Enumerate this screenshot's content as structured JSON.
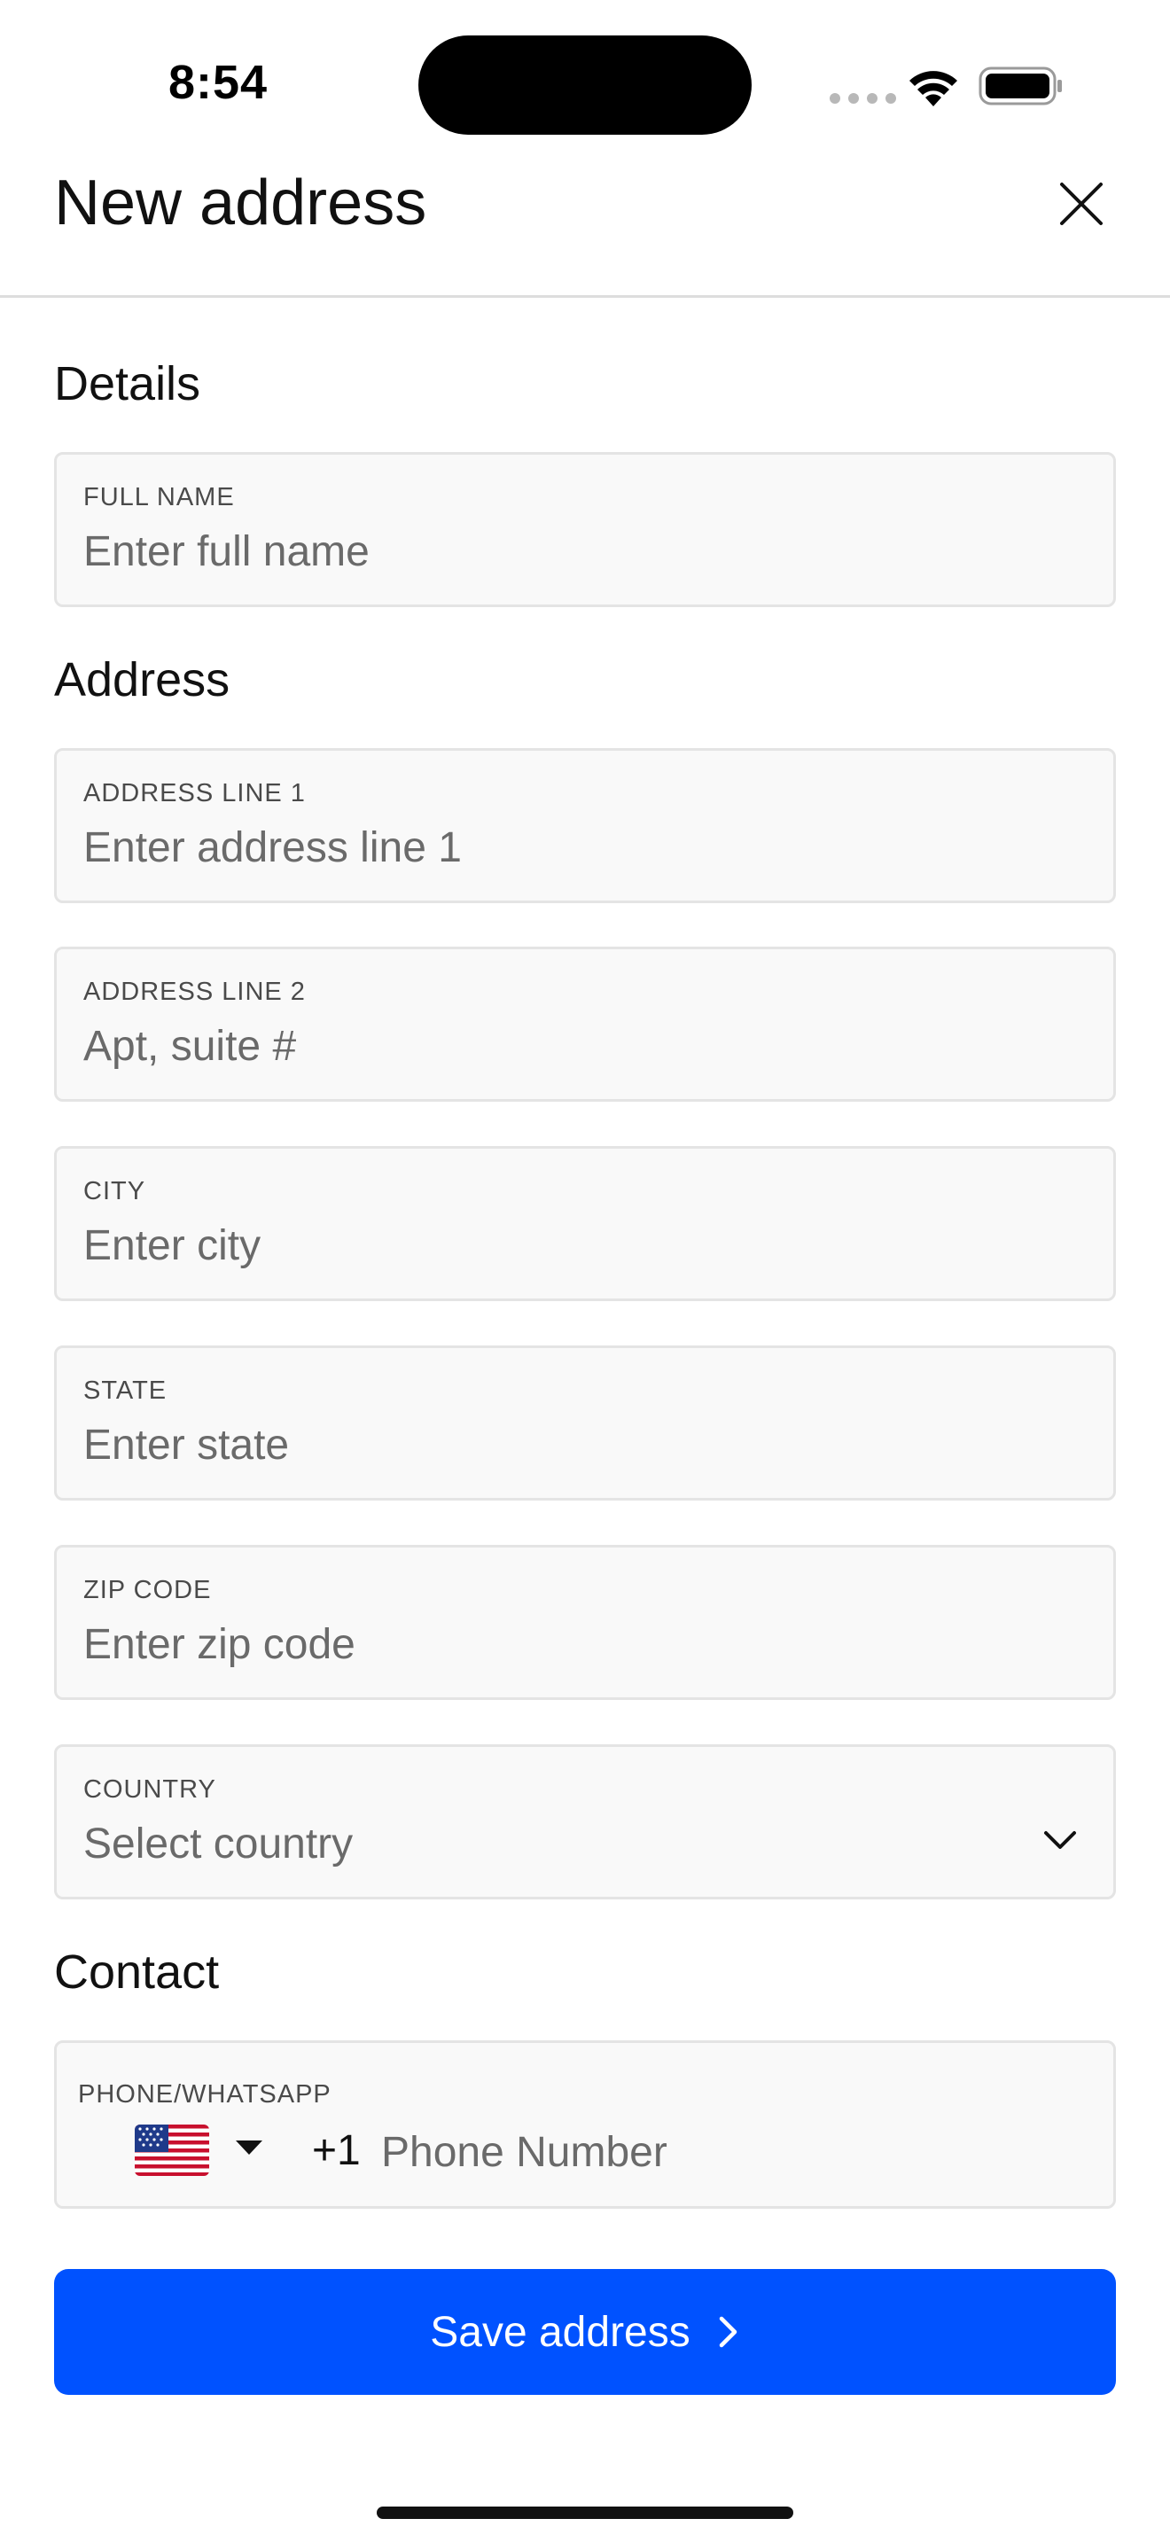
{
  "status_bar": {
    "time": "8:54"
  },
  "header": {
    "title": "New address",
    "close_icon": "close-icon"
  },
  "sections": {
    "details_title": "Details",
    "address_title": "Address",
    "contact_title": "Contact"
  },
  "fields": {
    "full_name": {
      "label": "FULL NAME",
      "placeholder": "Enter full name",
      "value": ""
    },
    "address_line_1": {
      "label": "ADDRESS LINE 1",
      "placeholder": "Enter address line 1",
      "value": ""
    },
    "address_line_2": {
      "label": "ADDRESS LINE 2",
      "placeholder": "Apt, suite #",
      "value": ""
    },
    "city": {
      "label": "CITY",
      "placeholder": "Enter city",
      "value": ""
    },
    "state": {
      "label": "STATE",
      "placeholder": "Enter state",
      "value": ""
    },
    "zip_code": {
      "label": "ZIP CODE",
      "placeholder": "Enter zip code",
      "value": ""
    },
    "country": {
      "label": "COUNTRY",
      "placeholder": "Select country",
      "value": ""
    },
    "phone": {
      "label": "PHONE/WHATSAPP",
      "dial_code": "+1",
      "placeholder": "Phone Number",
      "flag_icon": "us-flag-icon",
      "value": ""
    }
  },
  "actions": {
    "save_label": "Save address"
  },
  "colors": {
    "accent": "#0052ff",
    "field_bg": "#f9f9f9",
    "field_border": "#e4e4e4",
    "placeholder": "#6a6a6a"
  }
}
